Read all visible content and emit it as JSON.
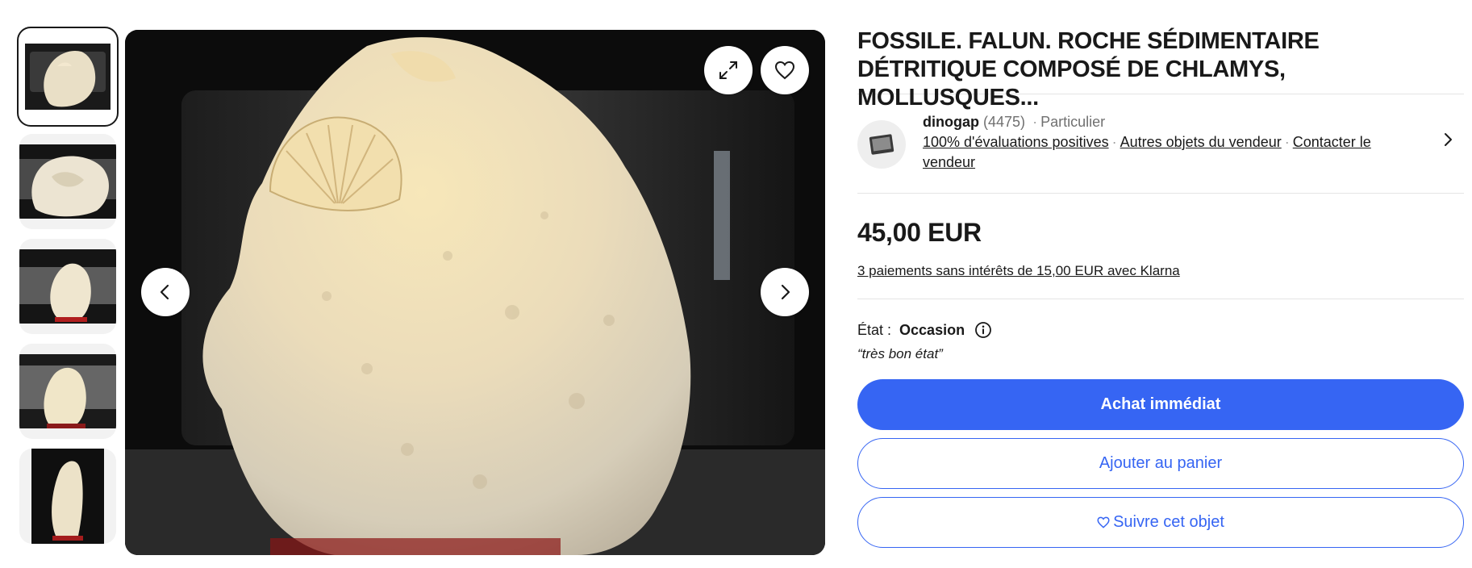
{
  "gallery": {
    "thumbnails": [
      {
        "alt": "thumbnail-1"
      },
      {
        "alt": "thumbnail-2"
      },
      {
        "alt": "thumbnail-3"
      },
      {
        "alt": "thumbnail-4"
      },
      {
        "alt": "thumbnail-5"
      }
    ],
    "icons": {
      "expand": "expand-icon",
      "favorite": "heart-icon",
      "prev": "chevron-left-icon",
      "next": "chevron-right-icon"
    }
  },
  "item": {
    "title": "FOSSILE. FALUN. ROCHE SÉDIMENTAIRE DÉTRITIQUE COMPOSÉ DE CHLAMYS, MOLLUSQUES..."
  },
  "seller": {
    "name": "dinogap",
    "feedback_count": "(4475)",
    "type": "Particulier",
    "positive": "100% d'évaluations positives",
    "other_items": "Autres objets du vendeur",
    "contact": "Contacter le vendeur"
  },
  "price": {
    "amount": "45,00 EUR",
    "klarna": "3 paiements sans intérêts de 15,00 EUR avec Klarna"
  },
  "condition": {
    "label": "État :",
    "value": "Occasion",
    "note": "“très bon état”"
  },
  "actions": {
    "buy_now": "Achat immédiat",
    "add_to_cart": "Ajouter au panier",
    "watch": "Suivre cet objet"
  },
  "colors": {
    "primary": "#3665f3",
    "text": "#191919",
    "muted": "#707070"
  }
}
